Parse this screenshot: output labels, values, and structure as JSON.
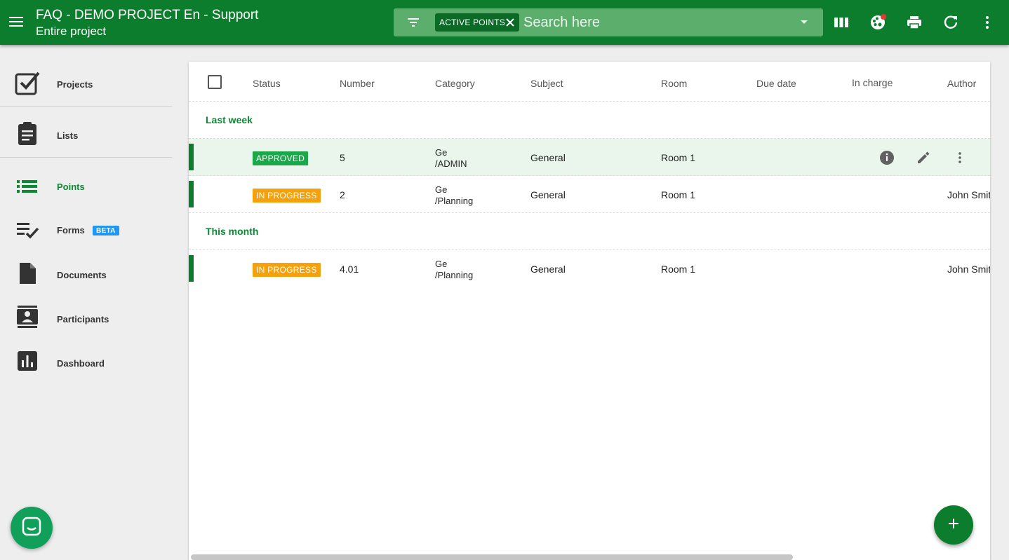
{
  "header": {
    "title": "FAQ - DEMO PROJECT En - Support",
    "subtitle": "Entire project"
  },
  "search": {
    "chip_label": "ACTIVE POINTS",
    "placeholder": "Search here"
  },
  "toolbar_icons": [
    "columns-icon",
    "palette-icon",
    "print-icon",
    "refresh-icon",
    "more-vert-icon"
  ],
  "colors": {
    "primary": "#0b7d2c",
    "accent_text": "#0b8a33",
    "approved": "#1aa84b",
    "in_progress": "#f5a10b",
    "beta": "#2196f3",
    "notification_dot": "#e53935"
  },
  "sidebar": {
    "items": [
      {
        "label": "Projects",
        "icon": "projects-check-icon"
      },
      {
        "label": "Lists",
        "icon": "clipboard-icon"
      },
      {
        "label": "Points",
        "icon": "list-icon"
      },
      {
        "label": "Forms",
        "icon": "checklist-icon",
        "badge": "BETA"
      },
      {
        "label": "Documents",
        "icon": "document-icon"
      },
      {
        "label": "Participants",
        "icon": "contacts-icon"
      },
      {
        "label": "Dashboard",
        "icon": "bar-chart-icon"
      }
    ],
    "active": "Points"
  },
  "table": {
    "columns": [
      "Status",
      "Number",
      "Category",
      "Subject",
      "Room",
      "Due date",
      "In charge",
      "Author"
    ],
    "groups": [
      {
        "label": "Last week",
        "rows": [
          {
            "status": "APPROVED",
            "number": "5",
            "category_line1": "Ge",
            "category_line2": "/ADMIN",
            "subject": "General",
            "room": "Room 1",
            "author": ""
          }
        ]
      },
      {
        "label": "",
        "rows": [
          {
            "status": "IN PROGRESS",
            "number": "2",
            "category_line1": "Ge",
            "category_line2": "/Planning",
            "subject": "General",
            "room": "Room 1",
            "author": "John Smith"
          }
        ]
      },
      {
        "label": "This month",
        "rows": [
          {
            "status": "IN PROGRESS",
            "number": "4.01",
            "category_line1": "Ge",
            "category_line2": "/Planning",
            "subject": "General",
            "room": "Room 1",
            "author": "John Smith"
          }
        ]
      }
    ]
  }
}
